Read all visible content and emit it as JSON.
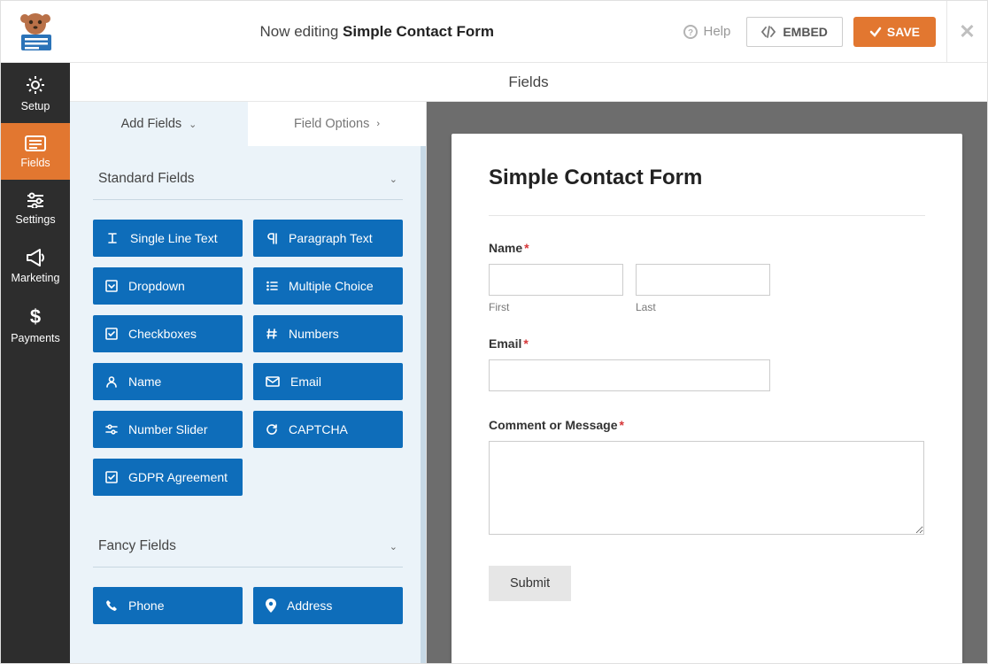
{
  "header": {
    "now_editing_prefix": "Now editing ",
    "form_name": "Simple Contact Form",
    "help": "Help",
    "embed": "EMBED",
    "save": "SAVE"
  },
  "leftnav": [
    {
      "id": "setup",
      "label": "Setup"
    },
    {
      "id": "fields",
      "label": "Fields"
    },
    {
      "id": "settings",
      "label": "Settings"
    },
    {
      "id": "marketing",
      "label": "Marketing"
    },
    {
      "id": "payments",
      "label": "Payments"
    }
  ],
  "mid_header": "Fields",
  "panel_tabs": {
    "add_fields": "Add Fields",
    "field_options": "Field Options"
  },
  "sections": {
    "standard": "Standard Fields",
    "fancy": "Fancy Fields"
  },
  "standard_fields": [
    {
      "icon": "text-cursor",
      "label": "Single Line Text"
    },
    {
      "icon": "paragraph",
      "label": "Paragraph Text"
    },
    {
      "icon": "caret-square",
      "label": "Dropdown"
    },
    {
      "icon": "list-ul",
      "label": "Multiple Choice"
    },
    {
      "icon": "check-square",
      "label": "Checkboxes"
    },
    {
      "icon": "hash",
      "label": "Numbers"
    },
    {
      "icon": "user",
      "label": "Name"
    },
    {
      "icon": "envelope",
      "label": "Email"
    },
    {
      "icon": "sliders",
      "label": "Number Slider"
    },
    {
      "icon": "refresh",
      "label": "CAPTCHA"
    },
    {
      "icon": "check-square",
      "label": "GDPR Agreement"
    }
  ],
  "fancy_fields": [
    {
      "icon": "phone",
      "label": "Phone"
    },
    {
      "icon": "map-marker",
      "label": "Address"
    }
  ],
  "preview": {
    "title": "Simple Contact Form",
    "name_label": "Name",
    "first": "First",
    "last": "Last",
    "email_label": "Email",
    "message_label": "Comment or Message",
    "submit": "Submit"
  }
}
